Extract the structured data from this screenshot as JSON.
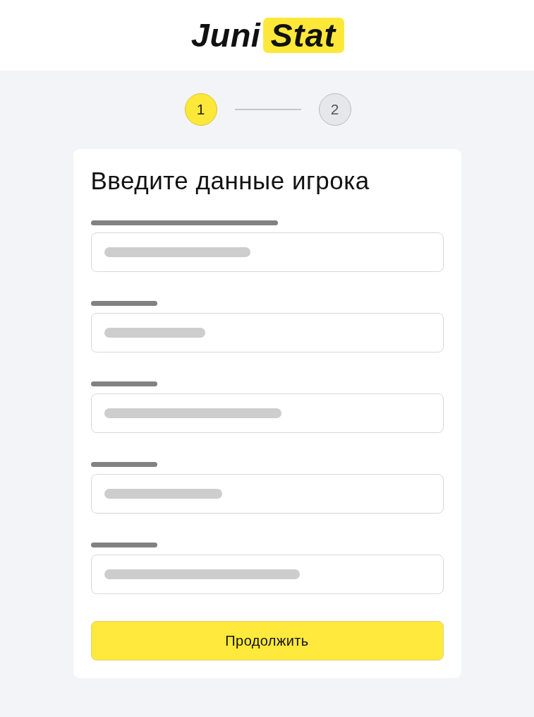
{
  "logo": {
    "text": "Juni",
    "highlight": "Stat"
  },
  "steps": [
    {
      "label": "1",
      "selected": true
    },
    {
      "label": "2",
      "selected": false
    }
  ],
  "form": {
    "title": "Введите данные игрока",
    "fields": [
      {
        "kind": "skeleton"
      },
      {
        "kind": "skeleton"
      },
      {
        "kind": "skeleton"
      },
      {
        "kind": "skeleton"
      },
      {
        "kind": "skeleton"
      }
    ],
    "submit": "Продолжить"
  }
}
